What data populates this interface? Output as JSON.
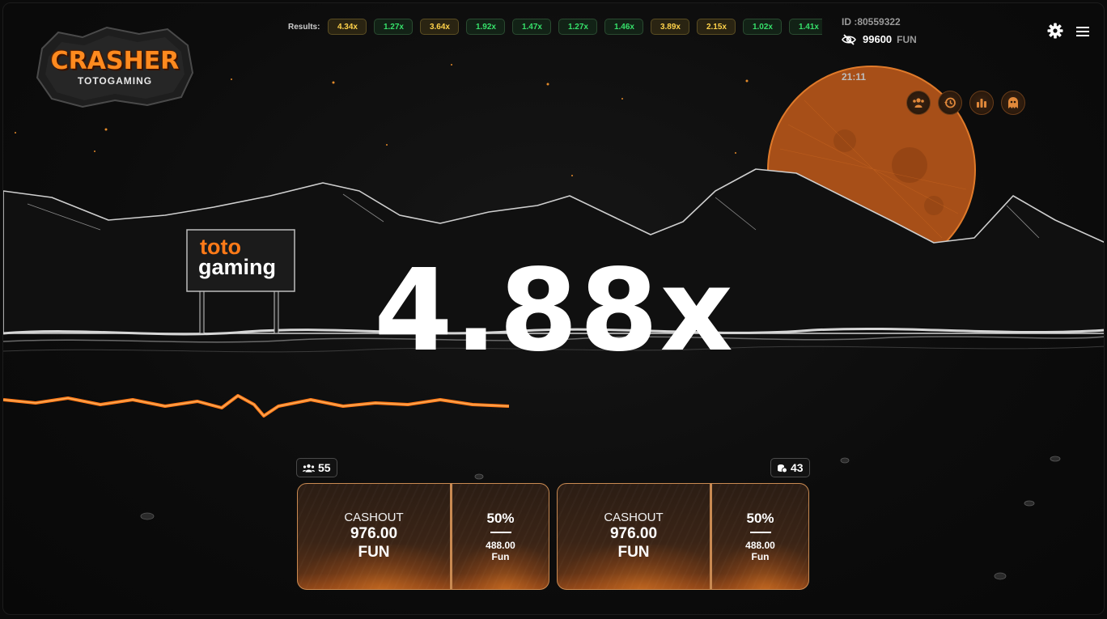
{
  "logo": {
    "title": "CRASHER",
    "subtitle": "TOTOGAMING"
  },
  "results": {
    "label": "Results:",
    "items": [
      {
        "value": "4.34x",
        "tone": "gold"
      },
      {
        "value": "1.27x",
        "tone": "green"
      },
      {
        "value": "3.64x",
        "tone": "gold"
      },
      {
        "value": "1.92x",
        "tone": "green"
      },
      {
        "value": "1.47x",
        "tone": "green"
      },
      {
        "value": "1.27x",
        "tone": "green"
      },
      {
        "value": "1.46x",
        "tone": "green"
      },
      {
        "value": "3.89x",
        "tone": "gold"
      },
      {
        "value": "2.15x",
        "tone": "gold"
      },
      {
        "value": "1.02x",
        "tone": "green"
      },
      {
        "value": "1.41x",
        "tone": "green"
      }
    ]
  },
  "account": {
    "id": "ID :80559322",
    "balance": "99600",
    "currency": "FUN",
    "time": "21:11"
  },
  "sign": {
    "line1": "toto",
    "line2": "gaming"
  },
  "game": {
    "multiplier": "4.88x"
  },
  "counters": {
    "players": "55",
    "bets": "43"
  },
  "bets": [
    {
      "cashout_label": "CASHOUT",
      "cashout_amount": "976.00",
      "cashout_currency": "FUN",
      "half_percent": "50%",
      "half_amount": "488.00",
      "half_currency": "Fun"
    },
    {
      "cashout_label": "CASHOUT",
      "cashout_amount": "976.00",
      "cashout_currency": "FUN",
      "half_percent": "50%",
      "half_amount": "488.00",
      "half_currency": "Fun"
    }
  ],
  "icons": {
    "settings": "gear-icon",
    "menu": "hamburger-menu-icon",
    "balance_visibility": "eye-slash-icon",
    "round_buttons": [
      "players-icon",
      "history-icon",
      "statistics-icon",
      "ghost-icon"
    ]
  },
  "colors": {
    "accent": "#ff8a1f",
    "gold_result": "#ffd24a",
    "green_result": "#36e06a",
    "panel_border": "#c98a52",
    "background": "#0b0b0b"
  }
}
